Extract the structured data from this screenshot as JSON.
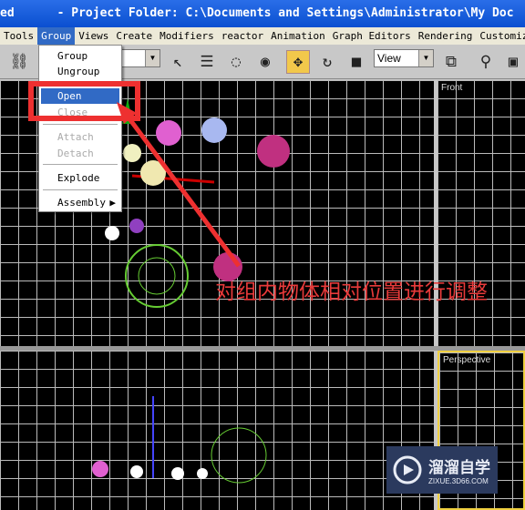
{
  "window": {
    "title": "ed      - Project Folder: C:\\Documents and Settings\\Administrator\\My Doc"
  },
  "menubar": {
    "items": [
      "Tools",
      "Group",
      "Views",
      "Create",
      "Modifiers",
      "reactor",
      "Animation",
      "Graph Editors",
      "Rendering",
      "Customize"
    ],
    "active": "Group"
  },
  "toolbar": {
    "selection_filter": "",
    "coord_system": "View"
  },
  "group_menu": {
    "items": [
      {
        "label": "Group",
        "enabled": true
      },
      {
        "label": "Ungroup",
        "enabled": true
      },
      {
        "label": "Open",
        "enabled": true,
        "highlighted": true
      },
      {
        "label": "Close",
        "enabled": false
      },
      {
        "label": "Attach",
        "enabled": false
      },
      {
        "label": "Detach",
        "enabled": false
      },
      {
        "label": "Explode",
        "enabled": true
      },
      {
        "label": "Assembly",
        "enabled": true,
        "submenu": true
      }
    ]
  },
  "viewports": {
    "front": "Front",
    "perspective": "Perspective"
  },
  "annotation": {
    "text": "对组内物体相对位置进行调整",
    "color": "#e83a3a"
  },
  "watermark": {
    "name": "溜溜自学",
    "url": "ZIXUE.3D66.COM"
  },
  "colors": {
    "highlight": "#316ac5",
    "title_bar": "#0a4fd0",
    "annotation_red": "#ee3030"
  }
}
